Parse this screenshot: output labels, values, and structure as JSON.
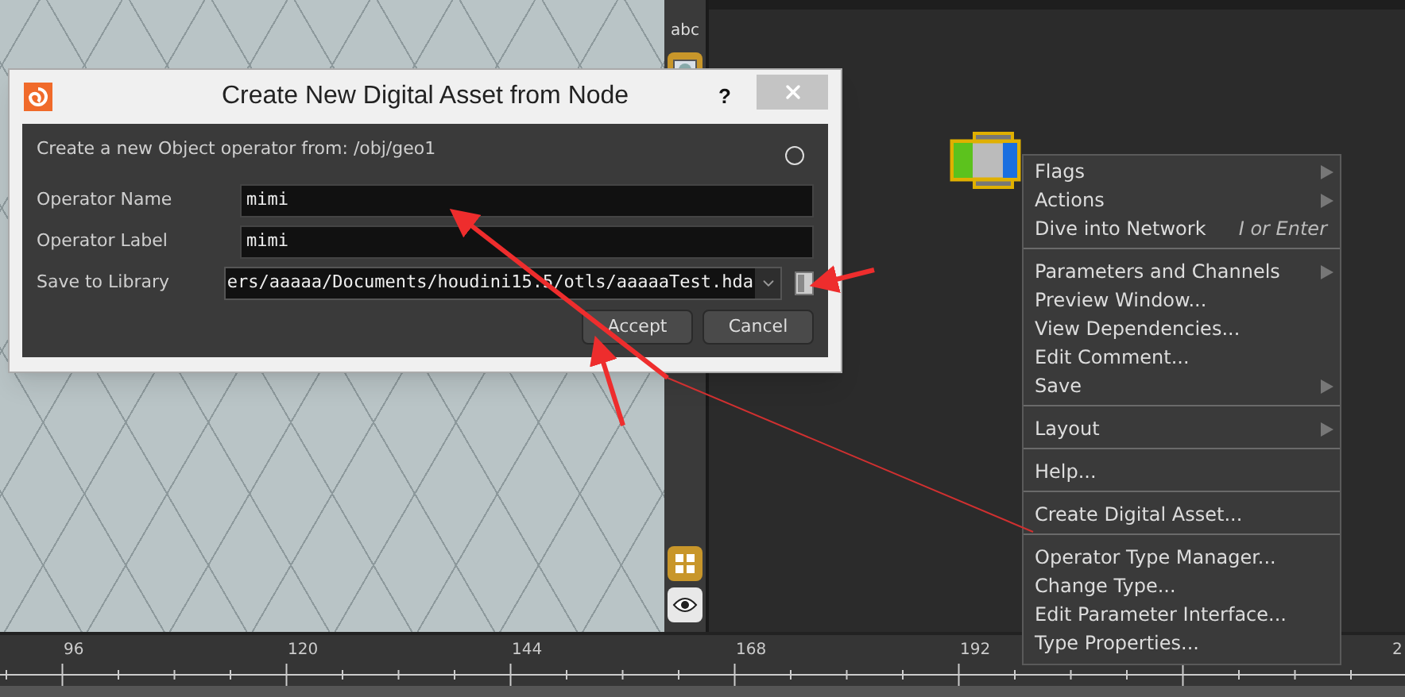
{
  "toolbar": {
    "label": "abc",
    "buttons": [
      {
        "kind": "image",
        "selected": true
      },
      {
        "kind": "grid",
        "selected": true
      },
      {
        "kind": "eye",
        "selected": false
      }
    ]
  },
  "dialog": {
    "title": "Create New Digital Asset from Node",
    "help": "?",
    "description": "Create a new Object operator from: /obj/geo1",
    "fields": [
      {
        "kind": "text",
        "label": "Operator Name",
        "value": "mimi"
      },
      {
        "kind": "text",
        "label": "Operator Label",
        "value": "mimi"
      },
      {
        "kind": "combo",
        "label": "Save to Library",
        "value": "ers/aaaaa/Documents/houdini15.5/otls/aaaaaTest.hda"
      }
    ],
    "buttons": [
      "Accept",
      "Cancel"
    ]
  },
  "context_menu": {
    "sections": [
      [
        {
          "label": "Flags",
          "submenu": true
        },
        {
          "label": "Actions",
          "submenu": true
        },
        {
          "label": "Dive into Network",
          "shortcut": "I or Enter",
          "submenu": false
        }
      ],
      [
        {
          "label": "Parameters and Channels",
          "submenu": true
        },
        {
          "label": "Preview Window...",
          "submenu": false
        },
        {
          "label": "View Dependencies...",
          "submenu": false
        },
        {
          "label": "Edit Comment...",
          "submenu": false
        },
        {
          "label": "Save",
          "submenu": true
        }
      ],
      [
        {
          "label": "Layout",
          "submenu": true
        }
      ],
      [
        {
          "label": "Help...",
          "submenu": false
        }
      ],
      [
        {
          "label": "Create Digital Asset...",
          "submenu": false
        }
      ],
      [
        {
          "label": "Operator Type Manager...",
          "submenu": false
        },
        {
          "label": "Change Type...",
          "submenu": false
        },
        {
          "label": "Edit Parameter Interface...",
          "submenu": false
        },
        {
          "label": "Type Properties...",
          "submenu": false
        }
      ]
    ]
  },
  "timeline": {
    "ticks": [
      "96",
      "120",
      "144",
      "168",
      "192",
      "2"
    ]
  }
}
